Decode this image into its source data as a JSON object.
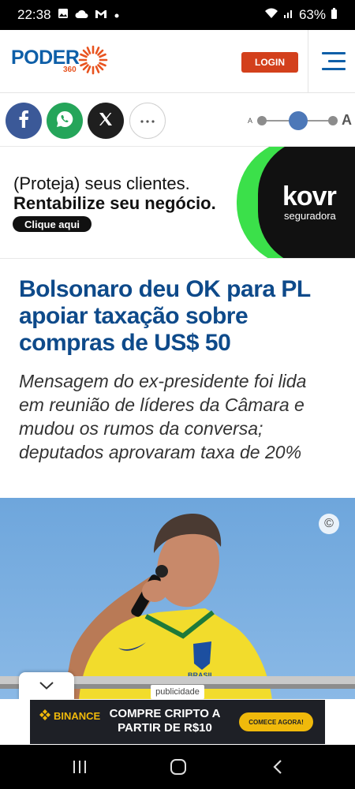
{
  "status_bar": {
    "time": "22:38",
    "battery": "63%",
    "left_icons": [
      "image-icon",
      "cloud-icon",
      "gmail-icon",
      "dot-icon"
    ],
    "right_icons": [
      "wifi-icon",
      "signal-icon",
      "battery-icon"
    ]
  },
  "header": {
    "logo_text": "PODER",
    "logo_sub": "360",
    "login_label": "LOGIN",
    "brand_color": "#0e5fa8",
    "accent_color": "#e8531f"
  },
  "share": {
    "buttons": [
      "facebook-icon",
      "whatsapp-icon",
      "x-icon",
      "more-icon"
    ],
    "font_small": "A",
    "font_large": "A",
    "font_size_level": 0.5
  },
  "ad_banner": {
    "line1": "(Proteja) seus clientes.",
    "line2": "Rentabilize seu negócio.",
    "cta": "Clique aqui",
    "brand": "kovr",
    "brand_sub": "seguradora"
  },
  "article": {
    "headline": "Bolsonaro deu OK para PL apoiar taxação sobre compras de US$ 50",
    "subtitle": "Mensagem do ex-presidente foi lida em reunião de líderes da Câmara e mudou os rumos da conversa; deputados aprovaram taxa de 20%"
  },
  "photo": {
    "copyright_symbol": "©",
    "shirt_text": "BRASIL"
  },
  "ad_label": "publicidade",
  "bottom_ad": {
    "brand": "BINANCE",
    "title": "COMPRE CRIPTO A PARTIR DE R$10",
    "cta": "COMECE AGORA!"
  },
  "nav": {
    "buttons": [
      "recent-apps-icon",
      "home-icon",
      "back-icon"
    ]
  }
}
